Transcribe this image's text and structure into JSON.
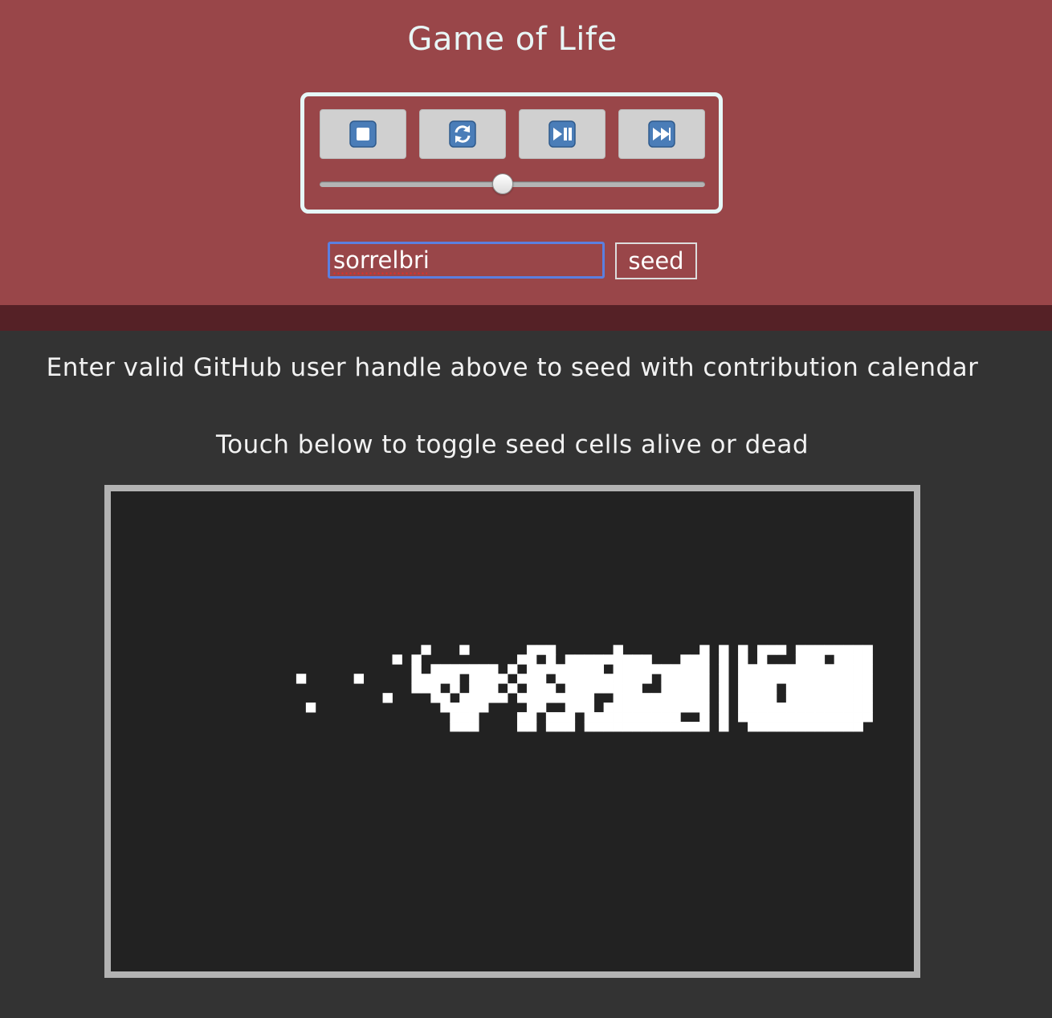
{
  "app": {
    "title": "Game of Life"
  },
  "controls": {
    "buttons": [
      {
        "name": "stop-button",
        "icon": "stop-icon"
      },
      {
        "name": "reset-button",
        "icon": "refresh-icon"
      },
      {
        "name": "play-pause-button",
        "icon": "play-pause-icon"
      },
      {
        "name": "fast-forward-button",
        "icon": "fast-forward-icon"
      }
    ],
    "speed_fraction": 0.476
  },
  "seed": {
    "input_value": "sorrelbri",
    "button_label": "seed"
  },
  "instructions": {
    "line1": "Enter valid GitHub user handle above to seed with contribution calendar",
    "line2": "Touch below to toggle seed cells alive or dead"
  },
  "board": {
    "rows": 50,
    "cols": 83,
    "live_cells": [
      [
        16,
        32
      ],
      [
        17,
        31
      ],
      [
        16,
        36
      ],
      [
        16,
        43
      ],
      [
        16,
        44
      ],
      [
        16,
        45
      ],
      [
        16,
        52
      ],
      [
        16,
        61
      ],
      [
        16,
        63
      ],
      [
        16,
        65
      ],
      [
        16,
        67
      ],
      [
        16,
        68
      ],
      [
        16,
        69
      ],
      [
        16,
        71
      ],
      [
        16,
        72
      ],
      [
        16,
        73
      ],
      [
        16,
        74
      ],
      [
        16,
        75
      ],
      [
        16,
        76
      ],
      [
        16,
        77
      ],
      [
        16,
        78
      ],
      [
        17,
        29
      ],
      [
        17,
        42
      ],
      [
        17,
        43
      ],
      [
        17,
        45
      ],
      [
        17,
        47
      ],
      [
        17,
        48
      ],
      [
        17,
        49
      ],
      [
        17,
        50
      ],
      [
        17,
        51
      ],
      [
        17,
        52
      ],
      [
        17,
        53
      ],
      [
        17,
        54
      ],
      [
        17,
        55
      ],
      [
        17,
        59
      ],
      [
        17,
        60
      ],
      [
        17,
        61
      ],
      [
        17,
        63
      ],
      [
        17,
        65
      ],
      [
        17,
        67
      ],
      [
        17,
        71
      ],
      [
        17,
        72
      ],
      [
        17,
        73
      ],
      [
        17,
        75
      ],
      [
        17,
        76
      ],
      [
        17,
        77
      ],
      [
        17,
        78
      ],
      [
        18,
        31
      ],
      [
        18,
        33
      ],
      [
        18,
        34
      ],
      [
        18,
        35
      ],
      [
        18,
        36
      ],
      [
        18,
        37
      ],
      [
        18,
        38
      ],
      [
        18,
        39
      ],
      [
        18,
        41
      ],
      [
        18,
        43
      ],
      [
        18,
        44
      ],
      [
        18,
        45
      ],
      [
        18,
        46
      ],
      [
        18,
        47
      ],
      [
        18,
        48
      ],
      [
        18,
        49
      ],
      [
        18,
        50
      ],
      [
        18,
        52
      ],
      [
        18,
        53
      ],
      [
        18,
        54
      ],
      [
        18,
        55
      ],
      [
        18,
        56
      ],
      [
        18,
        57
      ],
      [
        18,
        58
      ],
      [
        18,
        59
      ],
      [
        18,
        60
      ],
      [
        18,
        61
      ],
      [
        18,
        63
      ],
      [
        18,
        65
      ],
      [
        18,
        66
      ],
      [
        18,
        67
      ],
      [
        18,
        68
      ],
      [
        18,
        69
      ],
      [
        18,
        70
      ],
      [
        18,
        71
      ],
      [
        18,
        72
      ],
      [
        18,
        73
      ],
      [
        18,
        74
      ],
      [
        18,
        75
      ],
      [
        18,
        76
      ],
      [
        18,
        77
      ],
      [
        18,
        78
      ],
      [
        19,
        19
      ],
      [
        19,
        25
      ],
      [
        19,
        31
      ],
      [
        19,
        32
      ],
      [
        19,
        33
      ],
      [
        19,
        34
      ],
      [
        19,
        35
      ],
      [
        19,
        37
      ],
      [
        19,
        38
      ],
      [
        19,
        39
      ],
      [
        19,
        40
      ],
      [
        19,
        42
      ],
      [
        19,
        43
      ],
      [
        19,
        44
      ],
      [
        19,
        46
      ],
      [
        19,
        47
      ],
      [
        19,
        48
      ],
      [
        19,
        49
      ],
      [
        19,
        50
      ],
      [
        19,
        51
      ],
      [
        19,
        52
      ],
      [
        19,
        53
      ],
      [
        19,
        54
      ],
      [
        19,
        55
      ],
      [
        19,
        57
      ],
      [
        19,
        58
      ],
      [
        19,
        59
      ],
      [
        19,
        60
      ],
      [
        19,
        61
      ],
      [
        19,
        63
      ],
      [
        19,
        65
      ],
      [
        19,
        66
      ],
      [
        19,
        67
      ],
      [
        19,
        68
      ],
      [
        19,
        69
      ],
      [
        19,
        70
      ],
      [
        19,
        71
      ],
      [
        19,
        72
      ],
      [
        19,
        73
      ],
      [
        19,
        74
      ],
      [
        19,
        75
      ],
      [
        19,
        76
      ],
      [
        19,
        77
      ],
      [
        19,
        78
      ],
      [
        20,
        31
      ],
      [
        20,
        32
      ],
      [
        20,
        33
      ],
      [
        20,
        35
      ],
      [
        20,
        37
      ],
      [
        20,
        38
      ],
      [
        20,
        39
      ],
      [
        20,
        41
      ],
      [
        20,
        43
      ],
      [
        20,
        44
      ],
      [
        20,
        45
      ],
      [
        20,
        47
      ],
      [
        20,
        48
      ],
      [
        20,
        49
      ],
      [
        20,
        50
      ],
      [
        20,
        51
      ],
      [
        20,
        52
      ],
      [
        20,
        53
      ],
      [
        20,
        54
      ],
      [
        20,
        57
      ],
      [
        20,
        58
      ],
      [
        20,
        59
      ],
      [
        20,
        60
      ],
      [
        20,
        61
      ],
      [
        20,
        63
      ],
      [
        20,
        65
      ],
      [
        20,
        66
      ],
      [
        20,
        67
      ],
      [
        20,
        68
      ],
      [
        20,
        70
      ],
      [
        20,
        71
      ],
      [
        20,
        72
      ],
      [
        20,
        73
      ],
      [
        20,
        74
      ],
      [
        20,
        75
      ],
      [
        20,
        76
      ],
      [
        20,
        77
      ],
      [
        20,
        78
      ],
      [
        21,
        28
      ],
      [
        21,
        33
      ],
      [
        21,
        34
      ],
      [
        21,
        36
      ],
      [
        21,
        37
      ],
      [
        21,
        38
      ],
      [
        21,
        39
      ],
      [
        21,
        40
      ],
      [
        21,
        42
      ],
      [
        21,
        43
      ],
      [
        21,
        44
      ],
      [
        21,
        45
      ],
      [
        21,
        46
      ],
      [
        21,
        47
      ],
      [
        21,
        48
      ],
      [
        21,
        49
      ],
      [
        21,
        52
      ],
      [
        21,
        53
      ],
      [
        21,
        54
      ],
      [
        21,
        55
      ],
      [
        21,
        56
      ],
      [
        21,
        57
      ],
      [
        21,
        58
      ],
      [
        21,
        59
      ],
      [
        21,
        60
      ],
      [
        21,
        61
      ],
      [
        21,
        63
      ],
      [
        21,
        65
      ],
      [
        21,
        66
      ],
      [
        21,
        67
      ],
      [
        21,
        68
      ],
      [
        21,
        70
      ],
      [
        21,
        71
      ],
      [
        21,
        72
      ],
      [
        21,
        73
      ],
      [
        21,
        74
      ],
      [
        21,
        75
      ],
      [
        21,
        76
      ],
      [
        21,
        77
      ],
      [
        21,
        78
      ],
      [
        22,
        20
      ],
      [
        22,
        34
      ],
      [
        22,
        35
      ],
      [
        22,
        36
      ],
      [
        22,
        37
      ],
      [
        22,
        38
      ],
      [
        22,
        43
      ],
      [
        22,
        44
      ],
      [
        22,
        47
      ],
      [
        22,
        48
      ],
      [
        22,
        49
      ],
      [
        22,
        51
      ],
      [
        22,
        52
      ],
      [
        22,
        53
      ],
      [
        22,
        54
      ],
      [
        22,
        55
      ],
      [
        22,
        56
      ],
      [
        22,
        57
      ],
      [
        22,
        58
      ],
      [
        22,
        59
      ],
      [
        22,
        60
      ],
      [
        22,
        61
      ],
      [
        22,
        63
      ],
      [
        22,
        65
      ],
      [
        22,
        66
      ],
      [
        22,
        67
      ],
      [
        22,
        68
      ],
      [
        22,
        69
      ],
      [
        22,
        70
      ],
      [
        22,
        71
      ],
      [
        22,
        72
      ],
      [
        22,
        73
      ],
      [
        22,
        74
      ],
      [
        22,
        75
      ],
      [
        22,
        76
      ],
      [
        22,
        77
      ],
      [
        22,
        78
      ],
      [
        23,
        35
      ],
      [
        23,
        36
      ],
      [
        23,
        37
      ],
      [
        23,
        42
      ],
      [
        23,
        43
      ],
      [
        23,
        45
      ],
      [
        23,
        46
      ],
      [
        23,
        47
      ],
      [
        23,
        49
      ],
      [
        23,
        50
      ],
      [
        23,
        51
      ],
      [
        23,
        52
      ],
      [
        23,
        53
      ],
      [
        23,
        54
      ],
      [
        23,
        55
      ],
      [
        23,
        56
      ],
      [
        23,
        57
      ],
      [
        23,
        58
      ],
      [
        23,
        61
      ],
      [
        23,
        63
      ],
      [
        23,
        65
      ],
      [
        23,
        66
      ],
      [
        23,
        67
      ],
      [
        23,
        68
      ],
      [
        23,
        69
      ],
      [
        23,
        70
      ],
      [
        23,
        71
      ],
      [
        23,
        72
      ],
      [
        23,
        73
      ],
      [
        23,
        74
      ],
      [
        23,
        75
      ],
      [
        23,
        76
      ],
      [
        23,
        77
      ],
      [
        23,
        78
      ],
      [
        24,
        35
      ],
      [
        24,
        36
      ],
      [
        24,
        37
      ],
      [
        24,
        42
      ],
      [
        24,
        43
      ],
      [
        24,
        45
      ],
      [
        24,
        46
      ],
      [
        24,
        47
      ],
      [
        24,
        49
      ],
      [
        24,
        50
      ],
      [
        24,
        51
      ],
      [
        24,
        52
      ],
      [
        24,
        53
      ],
      [
        24,
        54
      ],
      [
        24,
        55
      ],
      [
        24,
        56
      ],
      [
        24,
        57
      ],
      [
        24,
        58
      ],
      [
        24,
        59
      ],
      [
        24,
        60
      ],
      [
        24,
        61
      ],
      [
        24,
        63
      ],
      [
        24,
        66
      ],
      [
        24,
        67
      ],
      [
        24,
        68
      ],
      [
        24,
        69
      ],
      [
        24,
        70
      ],
      [
        24,
        71
      ],
      [
        24,
        72
      ],
      [
        24,
        73
      ],
      [
        24,
        74
      ],
      [
        24,
        75
      ],
      [
        24,
        76
      ],
      [
        24,
        77
      ]
    ]
  },
  "colors": {
    "header_bg": "#994649",
    "header_stripe": "#552126",
    "page_bg": "#333333",
    "board_bg": "#222222",
    "board_border": "#b3b3b3",
    "cell_alive": "#ffffff",
    "icon_blue": "#3f6fa6"
  }
}
